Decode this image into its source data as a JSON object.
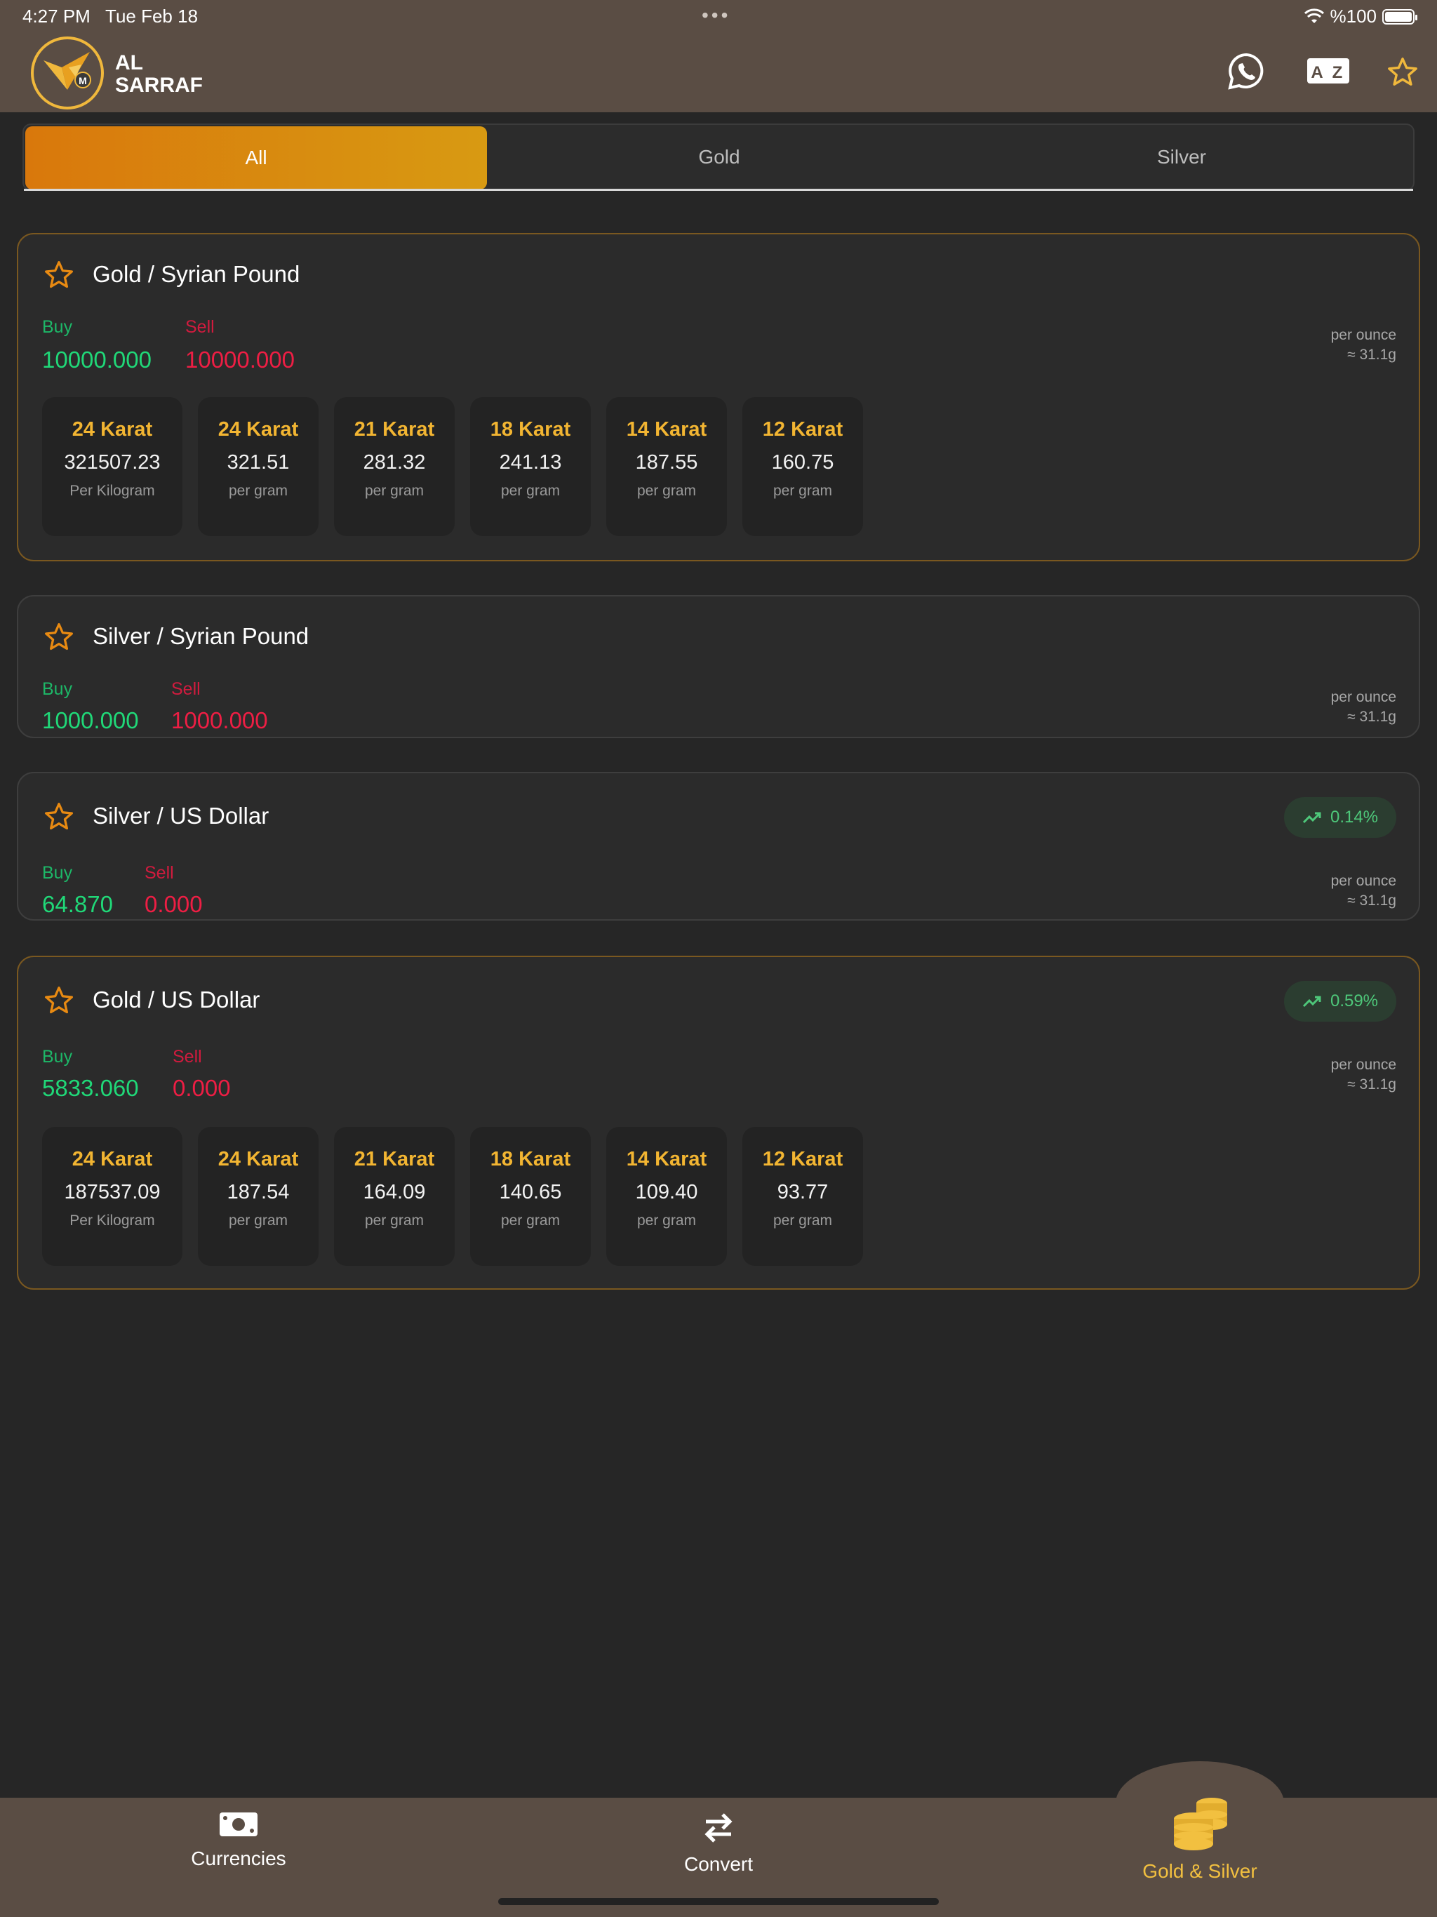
{
  "status_bar": {
    "time": "4:27 PM",
    "date": "Tue Feb 18",
    "battery": "%100"
  },
  "header": {
    "logo_line1": "AL",
    "logo_line2": "SARRAF",
    "logo_mark": "M",
    "icons": [
      "whatsapp-icon",
      "translate-icon",
      "star-icon"
    ],
    "accent": "#f0b83c"
  },
  "tabs": [
    {
      "label": "All",
      "active": true
    },
    {
      "label": "Gold",
      "active": false
    },
    {
      "label": "Silver",
      "active": false
    }
  ],
  "labels": {
    "buy": "Buy",
    "sell": "Sell",
    "per_ounce": "per ounce",
    "approx": "≈ 31.1g"
  },
  "cards": [
    {
      "title": "Gold / Syrian Pound",
      "buy": "10000.000",
      "sell": "10000.000",
      "karats": [
        {
          "name": "24 Karat",
          "value": "321507.23",
          "unit": "Per Kilogram"
        },
        {
          "name": "24 Karat",
          "value": "321.51",
          "unit": "per gram"
        },
        {
          "name": "21 Karat",
          "value": "281.32",
          "unit": "per gram"
        },
        {
          "name": "18 Karat",
          "value": "241.13",
          "unit": "per gram"
        },
        {
          "name": "14 Karat",
          "value": "187.55",
          "unit": "per gram"
        },
        {
          "name": "12 Karat",
          "value": "160.75",
          "unit": "per gram"
        }
      ]
    },
    {
      "title": "Silver / Syrian Pound",
      "buy": "1000.000",
      "sell": "1000.000"
    },
    {
      "title": "Silver / US Dollar",
      "buy": "64.870",
      "sell": "0.000",
      "change": "0.14%"
    },
    {
      "title": "Gold / US Dollar",
      "buy": "5833.060",
      "sell": "0.000",
      "change": "0.59%",
      "karats": [
        {
          "name": "24 Karat",
          "value": "187537.09",
          "unit": "Per Kilogram"
        },
        {
          "name": "24 Karat",
          "value": "187.54",
          "unit": "per gram"
        },
        {
          "name": "21 Karat",
          "value": "164.09",
          "unit": "per gram"
        },
        {
          "name": "18 Karat",
          "value": "140.65",
          "unit": "per gram"
        },
        {
          "name": "14 Karat",
          "value": "109.40",
          "unit": "per gram"
        },
        {
          "name": "12 Karat",
          "value": "93.77",
          "unit": "per gram"
        }
      ]
    }
  ],
  "bottom_nav": [
    {
      "label": "Currencies",
      "icon": "banknote-icon",
      "active": false
    },
    {
      "label": "Convert",
      "icon": "swap-arrows-icon",
      "active": false
    },
    {
      "label": "Gold & Silver",
      "icon": "coins-icon",
      "active": true
    }
  ]
}
